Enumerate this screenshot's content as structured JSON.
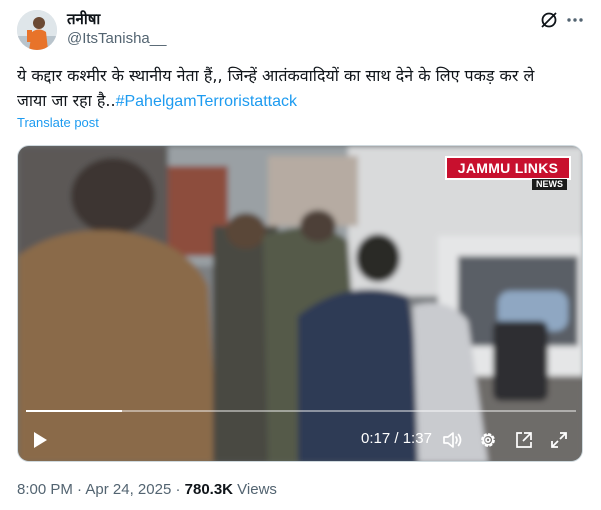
{
  "author": {
    "display_name": "तनीषा",
    "handle": "@ItsTanisha__"
  },
  "tweet": {
    "text_line1": "ये कद्दार कश्मीर के स्थानीय नेता हैं,, जिन्हें आतंकवादियों का साथ देने के लिए पकड़ कर ले",
    "text_line2": "जाया जा रहा है..",
    "hashtag": "#PahelgamTerroristattack",
    "translate_label": "Translate post"
  },
  "video": {
    "watermark_title": "JAMMU LINKS",
    "watermark_sub": "NEWS",
    "current_time": "0:17",
    "separator": " / ",
    "duration": "1:37",
    "progress_fraction": 0.175
  },
  "meta": {
    "time": "8:00 PM",
    "dot1": " · ",
    "date": "Apr 24, 2025",
    "dot2": " · ",
    "views": "780.3K",
    "views_label": " Views"
  },
  "icons": {
    "grok": "grok-icon",
    "more": "more-icon",
    "play": "play-icon",
    "volume": "volume-icon",
    "settings": "settings-icon",
    "pip": "pip-icon",
    "fullscreen": "fullscreen-icon"
  },
  "colors": {
    "link": "#1d9bf0",
    "text": "#0f1419",
    "secondary": "#536471",
    "logo_red": "#c8102e"
  }
}
